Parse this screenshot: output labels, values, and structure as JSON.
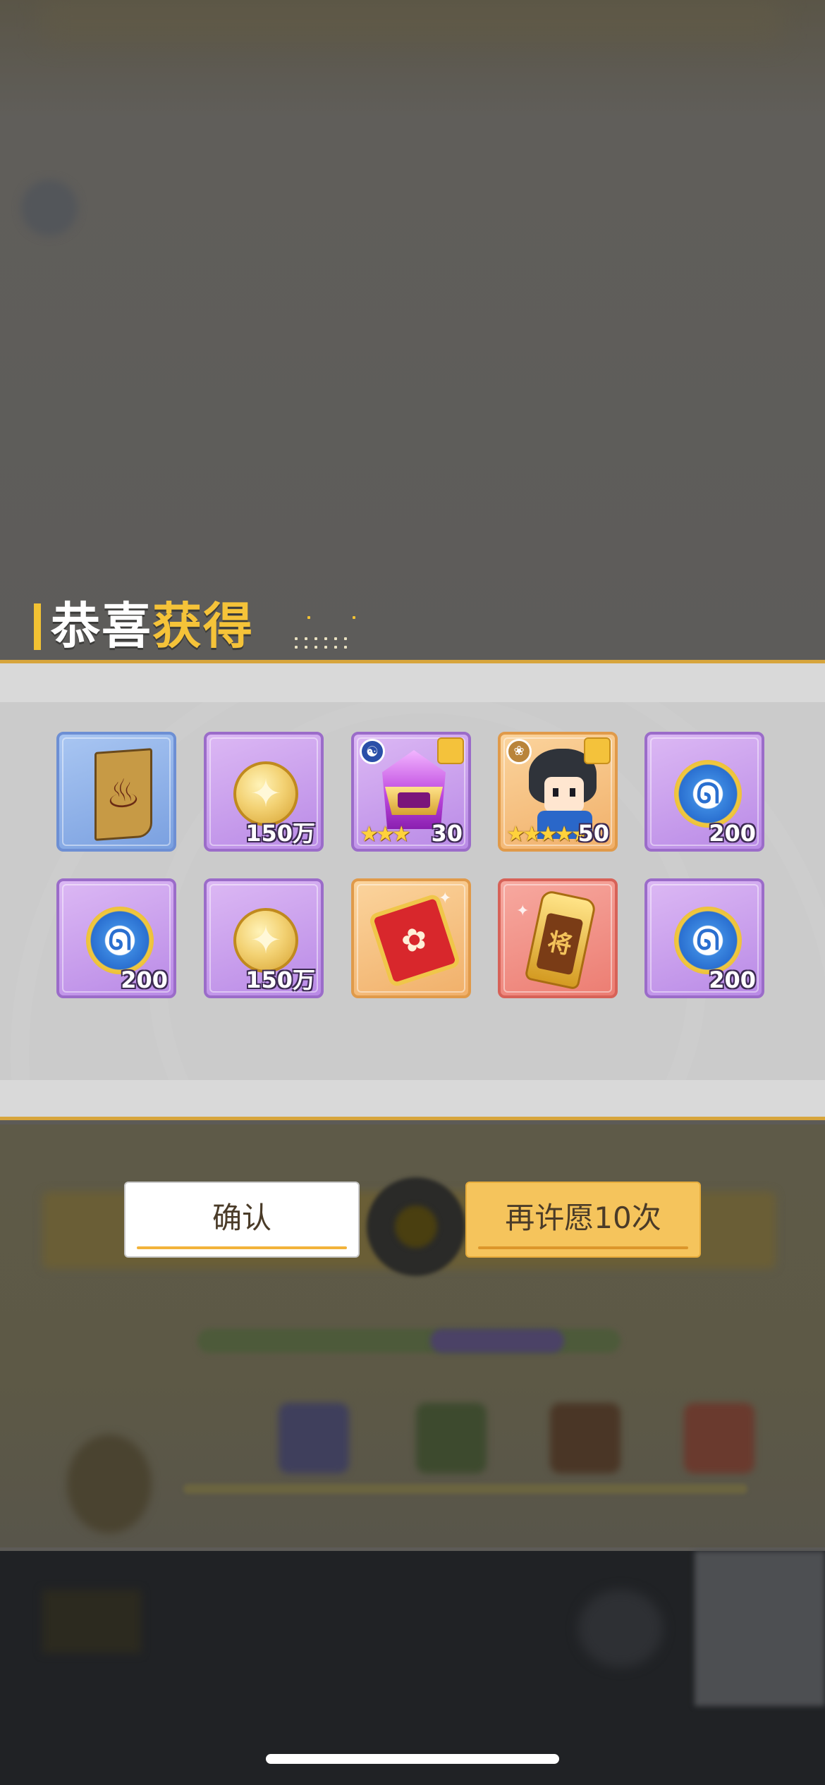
{
  "dialog": {
    "title_part1": "恭喜",
    "title_highlight": "获得",
    "title_part2": "得"
  },
  "rewards": [
    {
      "name": "banner-token",
      "rarity": "blue",
      "quantity": ""
    },
    {
      "name": "gold-coin",
      "rarity": "purple",
      "quantity": "150万"
    },
    {
      "name": "purple-helmet-shard",
      "rarity": "purple",
      "quantity": "30",
      "stars": "★★★"
    },
    {
      "name": "hero-shard",
      "rarity": "orange",
      "quantity": "50",
      "stars": "★★★★★"
    },
    {
      "name": "blue-wish-coin",
      "rarity": "purple",
      "quantity": "200"
    },
    {
      "name": "blue-wish-coin",
      "rarity": "purple",
      "quantity": "200"
    },
    {
      "name": "gold-coin",
      "rarity": "purple",
      "quantity": "150万"
    },
    {
      "name": "red-envelope-ticket",
      "rarity": "orange",
      "quantity": ""
    },
    {
      "name": "general-token",
      "rarity": "red",
      "quantity": "",
      "glyph": "将"
    },
    {
      "name": "blue-wish-coin",
      "rarity": "purple",
      "quantity": "200"
    }
  ],
  "buttons": {
    "confirm_label": "确认",
    "again_label": "再许愿10次"
  },
  "colors": {
    "accent": "#f5c339",
    "gold_line": "#d7a53c",
    "button_again": "#f5c45c"
  }
}
